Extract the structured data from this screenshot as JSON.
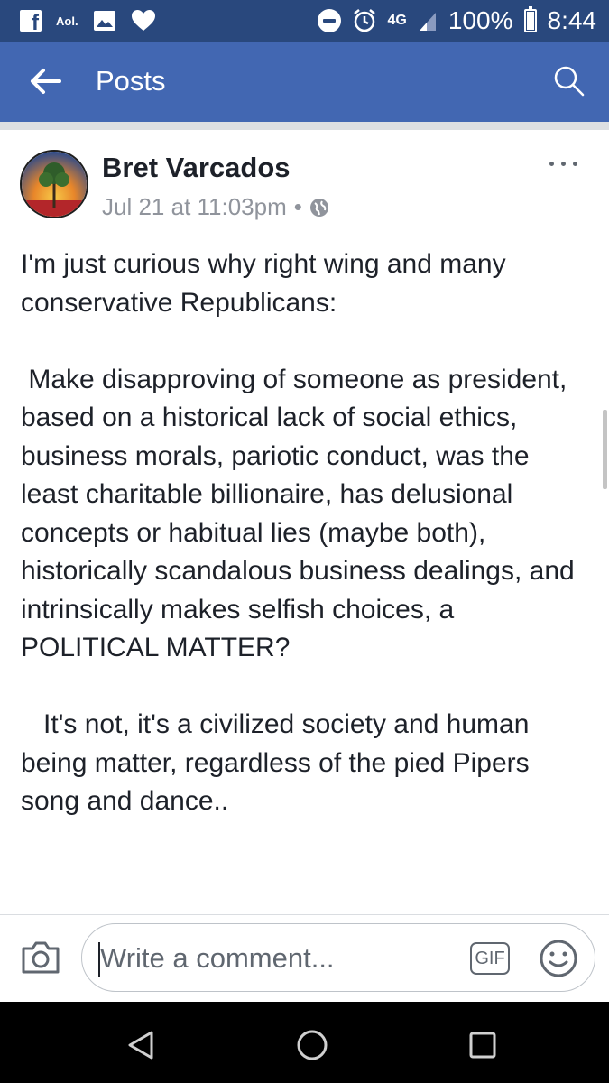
{
  "status_bar": {
    "carrier_badge": "Aol.",
    "network": "4G",
    "battery": "100%",
    "time": "8:44"
  },
  "app_bar": {
    "title": "Posts"
  },
  "post": {
    "author": "Bret Varcados",
    "timestamp": "Jul 21 at 11:03pm",
    "separator": "•",
    "privacy_icon": "globe-icon",
    "body": "I'm just curious why right wing and many conservative Republicans:\n\n Make disapproving of someone as president, based on a historical lack of social ethics, business morals, pariotic conduct, was the least charitable billionaire, has delusional concepts or habitual lies (maybe both), historically scandalous business dealings, and intrinsically makes selfish choices, a POLITICAL MATTER?\n\n   It's not, it's a civilized society and human being matter, regardless of the pied Pipers song and dance.."
  },
  "comment_bar": {
    "placeholder": "Write a comment...",
    "gif_label": "GIF"
  },
  "colors": {
    "status_bar": "#29487d",
    "app_bar": "#4267b2",
    "text": "#1d2129",
    "meta": "#90949c"
  }
}
